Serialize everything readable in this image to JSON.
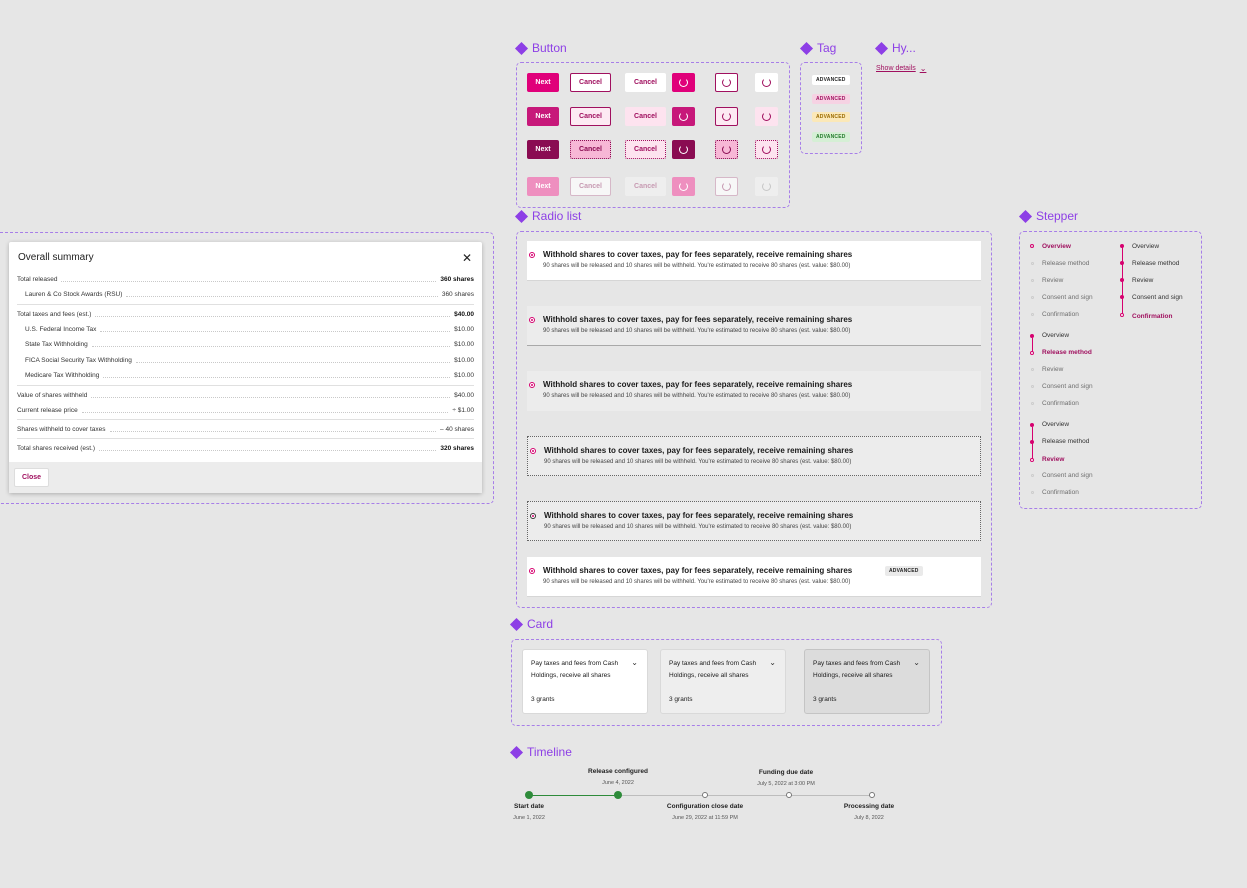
{
  "sections": {
    "button": "Button",
    "tag": "Tag",
    "hyperlink": "Hy...",
    "radio_list": "Radio list",
    "stepper": "Stepper",
    "card": "Card",
    "timeline": "Timeline"
  },
  "buttons": {
    "next": "Next",
    "cancel": "Cancel"
  },
  "tags": [
    "ADVANCED",
    "ADVANCED",
    "ADVANCED",
    "ADVANCED"
  ],
  "hyperlink": {
    "label": "Show details"
  },
  "summary": {
    "title": "Overall summary",
    "rows": [
      {
        "label": "Total released",
        "value": "360 shares"
      },
      {
        "label": "Lauren & Co Stock Awards (RSU)",
        "value": "360 shares"
      },
      {
        "label": "Total taxes and fees (est.)",
        "value": "$40.00"
      },
      {
        "label": "U.S. Federal Income Tax",
        "value": "$10.00"
      },
      {
        "label": "State Tax Withholding",
        "value": "$10.00"
      },
      {
        "label": "FICA Social Security Tax Withholding",
        "value": "$10.00"
      },
      {
        "label": "Medicare Tax Withholding",
        "value": "$10.00"
      },
      {
        "label": "Value of shares withheld",
        "value": "$40.00"
      },
      {
        "label": "Current release price",
        "value": "÷ $1.00"
      },
      {
        "label": "Shares withheld to cover taxes",
        "value": "– 40 shares"
      },
      {
        "label": "Total shares received (est.)",
        "value": "320 shares"
      }
    ],
    "close": "Close"
  },
  "radio": {
    "title": "Withhold shares to cover taxes, pay for fees separately, receive remaining shares",
    "subtitle": "90 shares will be released and 10 shares will be withheld. You're estimated to receive 80 shares (est. value: $80.00)",
    "tag": "ADVANCED"
  },
  "stepper": {
    "steps": [
      "Overview",
      "Release method",
      "Review",
      "Consent and sign",
      "Confirmation"
    ]
  },
  "card": {
    "title": "Pay taxes and fees from Cash Holdings, receive all shares",
    "grants": "3 grants"
  },
  "timeline": [
    {
      "title": "Start date",
      "date": "June 1, 2022"
    },
    {
      "title": "Release configured",
      "date": "June 4, 2022"
    },
    {
      "title": "Configuration close date",
      "date": "June 29, 2022 at 11:59 PM"
    },
    {
      "title": "Funding due date",
      "date": "July 5, 2022 at 3:00 PM"
    },
    {
      "title": "Processing date",
      "date": "July 8, 2022"
    }
  ],
  "colors": {
    "accent": "#a77ee8",
    "brand": "#d6006f",
    "brand_dark": "#a0105f"
  }
}
